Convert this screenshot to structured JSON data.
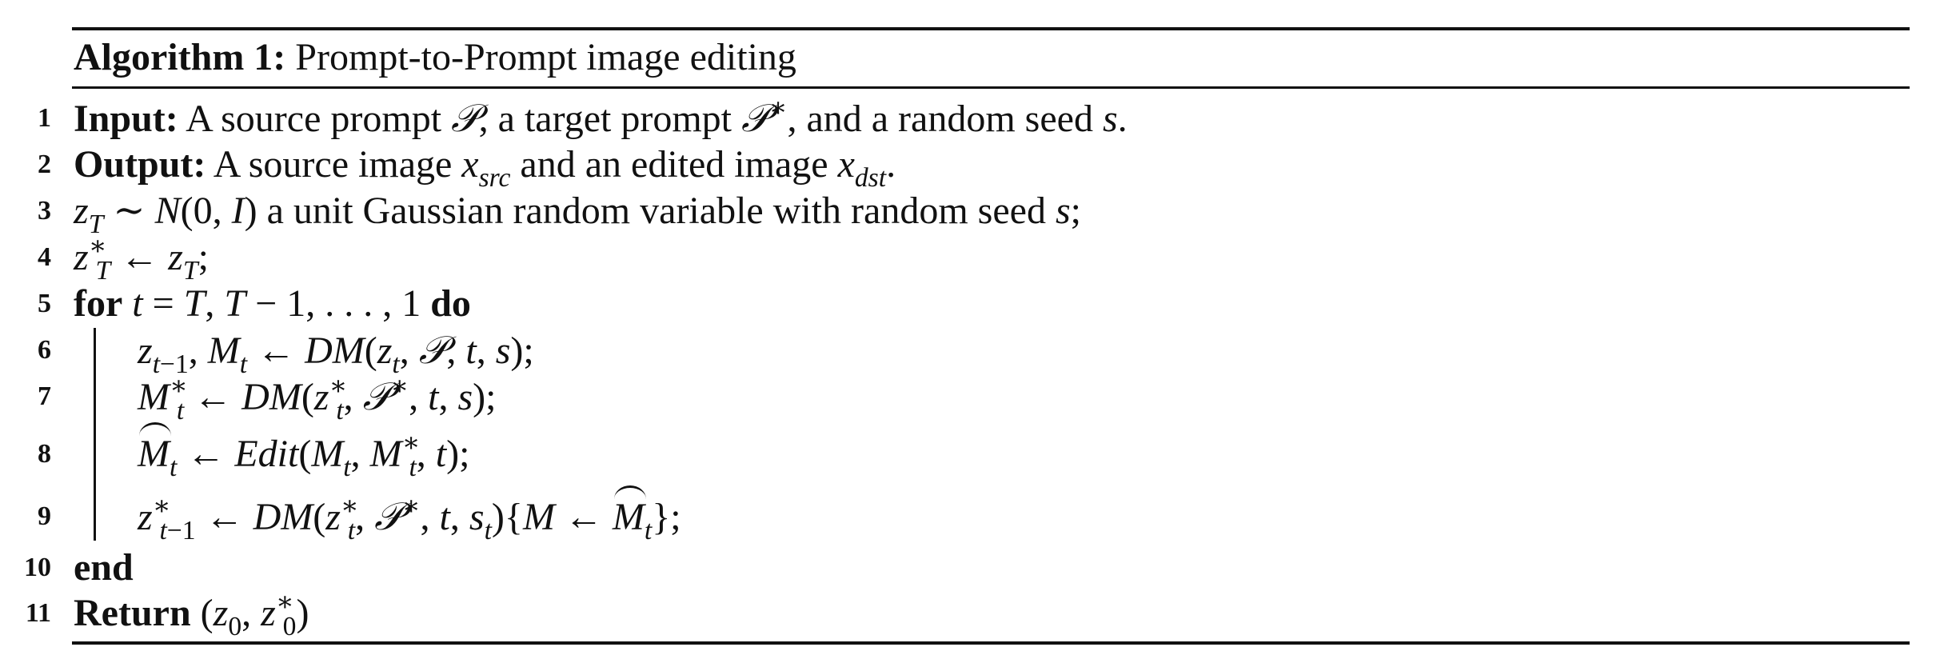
{
  "algorithm": {
    "caption_label": "Algorithm 1:",
    "caption_title": "Prompt-to-Prompt image editing",
    "lines": [
      {
        "num": "1",
        "text": "Input: A source prompt 𝒫, a target prompt 𝒫*, and a random seed s."
      },
      {
        "num": "2",
        "text": "Output: A source image x_src and an edited image x_dst."
      },
      {
        "num": "3",
        "text": "z_T ∼ N(0, I) a unit Gaussian random variable with random seed s;"
      },
      {
        "num": "4",
        "text": "z*_T ← z_T;"
      },
      {
        "num": "5",
        "text": "for t = T, T − 1, . . . , 1 do"
      },
      {
        "num": "6",
        "text": "z_{t−1}, M_t ← DM(z_t, 𝒫, t, s);"
      },
      {
        "num": "7",
        "text": "M*_t ← DM(z*_t, 𝒫*, t, s);"
      },
      {
        "num": "8",
        "text": "M̂_t ← Edit(M_t, M*_t, t);"
      },
      {
        "num": "9",
        "text": "z*_{t−1} ← DM(z*_t, 𝒫*, t, s_t){M ← M̂_t};"
      },
      {
        "num": "10",
        "text": "end"
      },
      {
        "num": "11",
        "text": "Return (z_0, z*_0)"
      }
    ]
  }
}
